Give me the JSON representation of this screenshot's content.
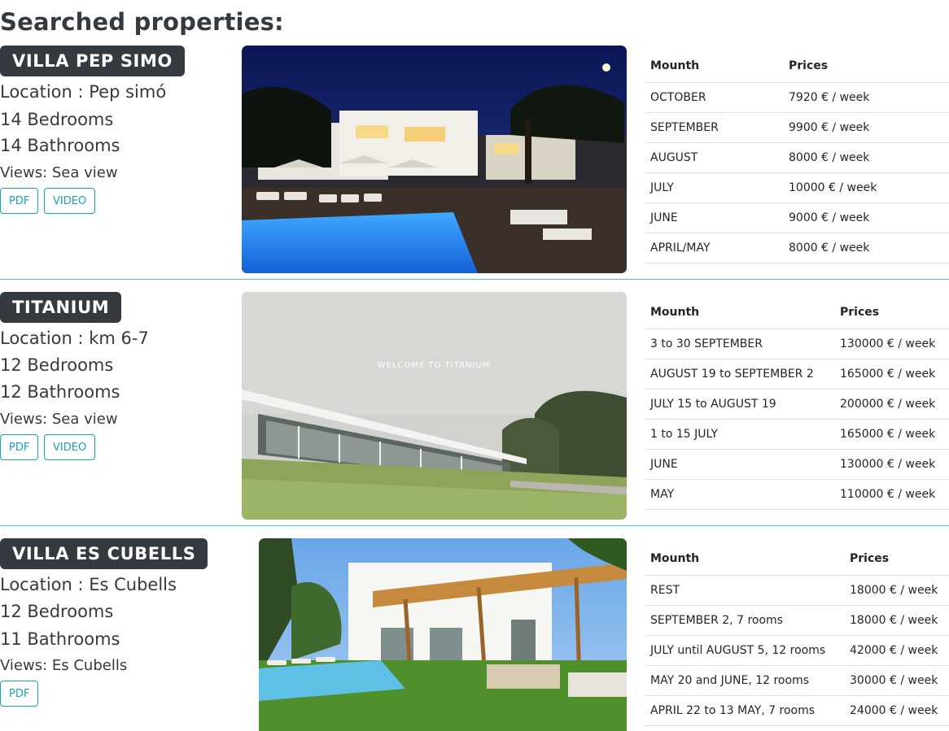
{
  "page": {
    "title": "Searched properties:"
  },
  "properties": [
    {
      "name": "VILLA PEP SIMO",
      "location": "Location : Pep simó",
      "bedrooms": "14 Bedrooms",
      "bathrooms": "14 Bathrooms",
      "views": "Views: Sea view",
      "buttons": {
        "pdf": "PDF",
        "video": "VIDEO"
      },
      "photo": "night villa with illuminated pool, lounge chairs and umbrellas",
      "table": {
        "headers": [
          "Mounth",
          "Prices"
        ],
        "rows": [
          [
            "OCTOBER",
            "7920 € / week"
          ],
          [
            "SEPTEMBER",
            "9900 € / week"
          ],
          [
            "AUGUST",
            "8000 € / week"
          ],
          [
            "JULY",
            "10000 € / week"
          ],
          [
            "JUNE",
            "9000 € / week"
          ],
          [
            "APRIL/MAY",
            "8000 € / week"
          ]
        ]
      }
    },
    {
      "name": "TITANIUM",
      "location": "Location : km 6-7",
      "bedrooms": "12 Bedrooms",
      "bathrooms": "12 Bathrooms",
      "views": "Views: Sea view",
      "buttons": {
        "pdf": "PDF",
        "video": "VIDEO"
      },
      "photo": "modern flat-roof house on a lawn",
      "photo_caption": "WELCOME TO TITANIUM",
      "table": {
        "headers": [
          "Mounth",
          "Prices"
        ],
        "rows": [
          [
            "3 to 30 SEPTEMBER",
            "130000 € / week"
          ],
          [
            "AUGUST 19 to SEPTEMBER 2",
            "165000 € / week"
          ],
          [
            "JULY 15 to AUGUST 19",
            "200000 € / week"
          ],
          [
            "1 to 15 JULY",
            "165000 € / week"
          ],
          [
            "JUNE",
            "130000 € / week"
          ],
          [
            "MAY",
            "110000 € / week"
          ]
        ]
      }
    },
    {
      "name": "VILLA ES CUBELLS",
      "location": "Location : Es Cubells",
      "bedrooms": "12 Bedrooms",
      "bathrooms": "11 Bathrooms",
      "views": "Views: Es Cubells",
      "buttons": {
        "pdf": "PDF"
      },
      "photo": "white villa with wooden pergola, palm trees and pool",
      "table": {
        "headers": [
          "Mounth",
          "Prices"
        ],
        "rows": [
          [
            "REST",
            "18000 € / week"
          ],
          [
            "SEPTEMBER 2, 7 rooms",
            "18000 € / week"
          ],
          [
            "JULY until AUGUST 5, 12 rooms",
            "42000 € / week"
          ],
          [
            "MAY 20 and JUNE, 12 rooms",
            "30000 € / week"
          ],
          [
            "APRIL 22 to 13 MAY, 7 rooms",
            "24000 € / week"
          ]
        ]
      }
    }
  ]
}
